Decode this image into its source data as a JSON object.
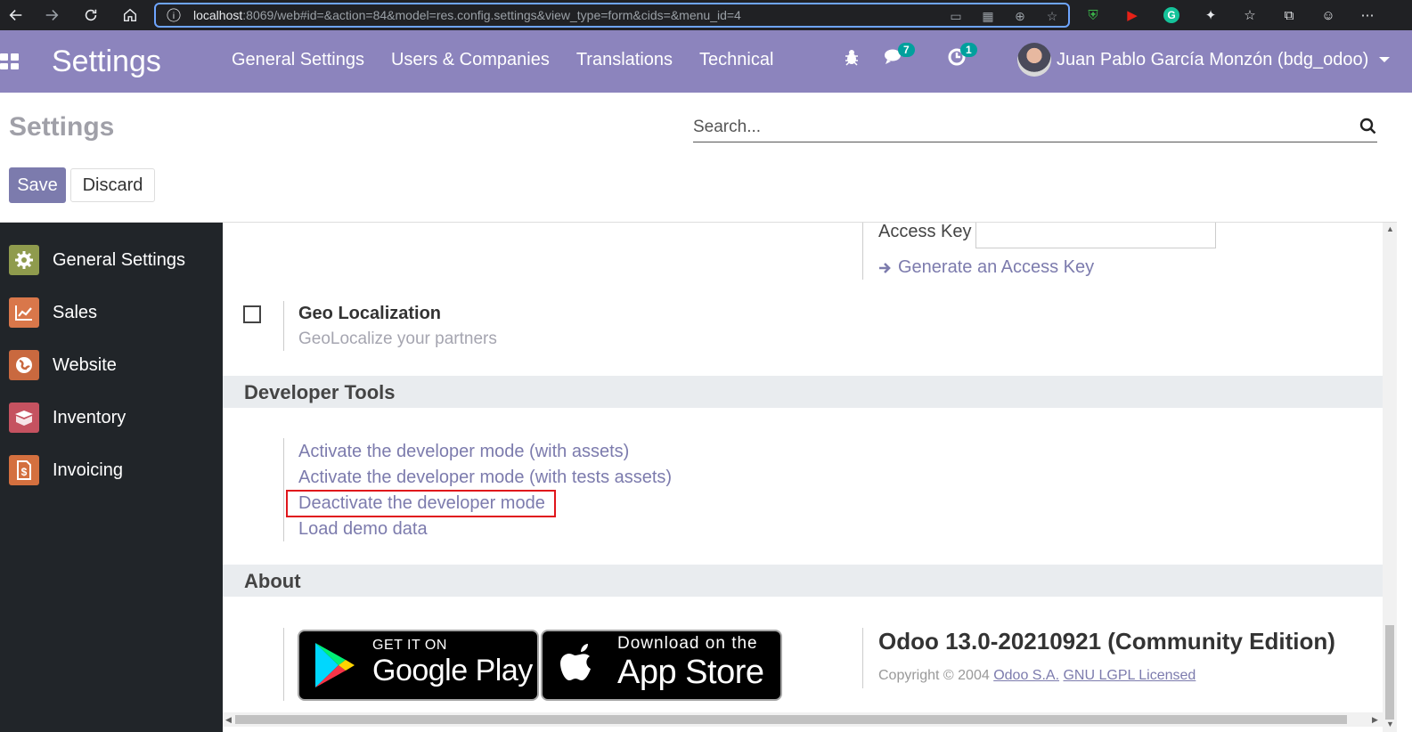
{
  "browser": {
    "url_host": "localhost",
    "url_rest": ":8069/web#id=&action=84&model=res.config.settings&view_type=form&cids=&menu_id=4"
  },
  "navbar": {
    "brand": "Settings",
    "menu": [
      "General Settings",
      "Users & Companies",
      "Translations",
      "Technical"
    ],
    "messages_count": "7",
    "activities_count": "1",
    "user_name": "Juan Pablo García Monzón (bdg_odoo)"
  },
  "control_panel": {
    "title": "Settings",
    "search_placeholder": "Search...",
    "save_label": "Save",
    "discard_label": "Discard"
  },
  "sidebar": {
    "items": [
      {
        "label": "General Settings",
        "icon": "gear-icon",
        "color": "#8f9b4d"
      },
      {
        "label": "Sales",
        "icon": "chart-icon",
        "color": "#d9774a"
      },
      {
        "label": "Website",
        "icon": "globe-icon",
        "color": "#c9693f"
      },
      {
        "label": "Inventory",
        "icon": "box-icon",
        "color": "#c55260"
      },
      {
        "label": "Invoicing",
        "icon": "invoice-icon",
        "color": "#d4703f"
      }
    ]
  },
  "content": {
    "access_key_label": "Access Key",
    "generate_link": "Generate an Access Key",
    "geo_title": "Geo Localization",
    "geo_desc": "GeoLocalize your partners",
    "dev_tools_heading": "Developer Tools",
    "dev_links": [
      "Activate the developer mode (with assets)",
      "Activate the developer mode (with tests assets)",
      "Deactivate the developer mode",
      "Load demo data"
    ],
    "about_heading": "About",
    "google_play_small": "GET IT ON",
    "google_play_big": "Google Play",
    "app_store_small": "Download on the",
    "app_store_big": "App Store",
    "version": "Odoo 13.0-20210921 (Community Edition)",
    "copyright_prefix": "Copyright © 2004",
    "company_link": "Odoo S.A.",
    "license_link": "GNU LGPL Licensed"
  },
  "colors": {
    "navbar": "#8c84bd",
    "accent": "#7c7bad",
    "sidebar": "#212529",
    "highlight": "#e0151b",
    "badge": "#00a09d"
  }
}
